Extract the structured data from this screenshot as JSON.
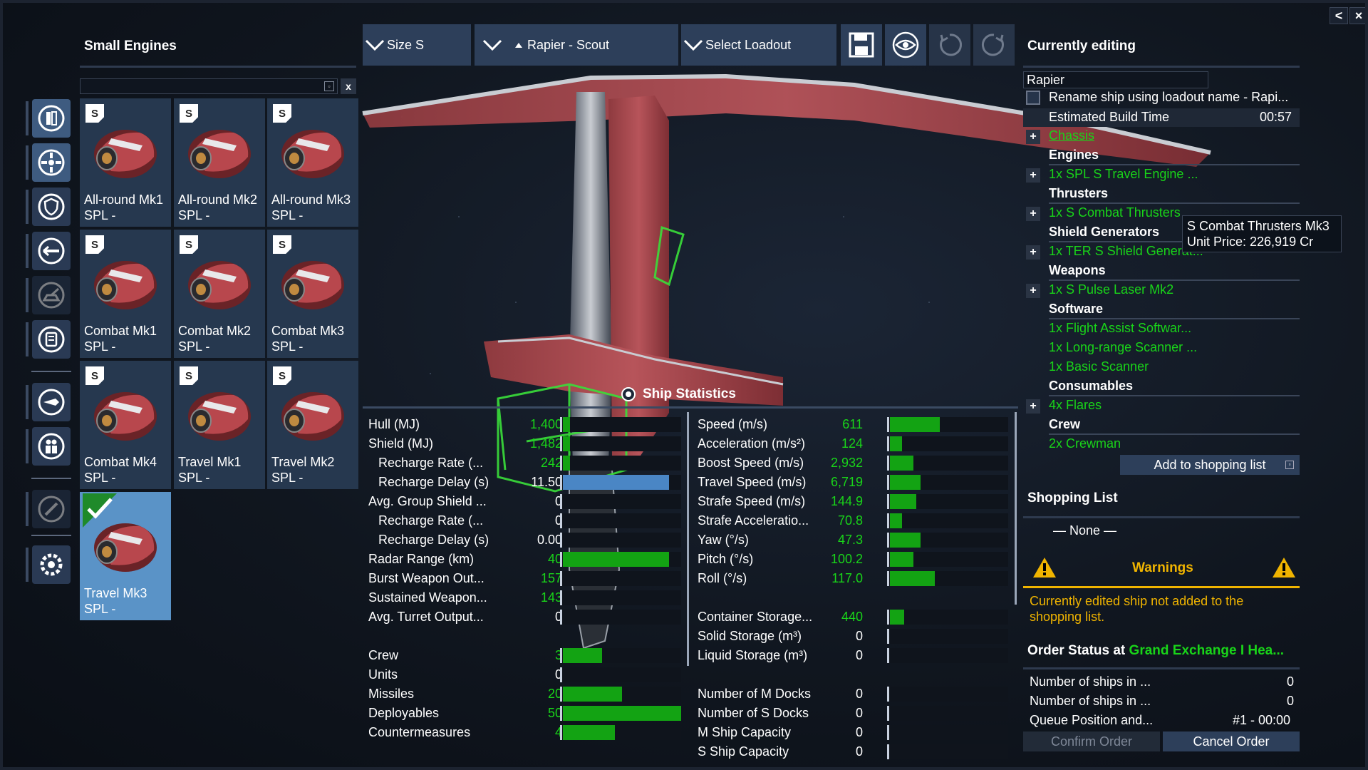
{
  "window_controls": {
    "back": "<",
    "close": "×"
  },
  "engines_panel": {
    "title": "Small Engines",
    "search_value": "",
    "search_clear_glyph": "▫",
    "clear_button": "x",
    "size_badge": "S",
    "items": [
      {
        "name": "All-round Mk1",
        "sub": "SPL -"
      },
      {
        "name": "All-round Mk2",
        "sub": "SPL -"
      },
      {
        "name": "All-round Mk3",
        "sub": "SPL -"
      },
      {
        "name": "Combat Mk1",
        "sub": "SPL -"
      },
      {
        "name": "Combat Mk2",
        "sub": "SPL -"
      },
      {
        "name": "Combat Mk3",
        "sub": "SPL -"
      },
      {
        "name": "Combat Mk4",
        "sub": "SPL -"
      },
      {
        "name": "Travel Mk1",
        "sub": "SPL -"
      },
      {
        "name": "Travel Mk2",
        "sub": "SPL -"
      },
      {
        "name": "Travel Mk3",
        "sub": "SPL -",
        "selected": true
      }
    ]
  },
  "rail_icons": [
    "chassis-icon",
    "engine-icon",
    "shield-icon",
    "weapon-icon",
    "turret-icon",
    "consumable-icon",
    "missile-icon",
    "crew-icon",
    "paint-icon",
    "settings-icon"
  ],
  "toolbar": {
    "size_label": "Size S",
    "ship_label": "Rapier - Scout",
    "loadout_label": "Select Loadout"
  },
  "stats": {
    "title": "Ship Statistics",
    "left": [
      {
        "label": "Hull (MJ)",
        "value": "1,400",
        "fraction": 0.06,
        "color": "green"
      },
      {
        "label": "Shield (MJ)",
        "value": "1,482",
        "fraction": 0.06,
        "color": "green"
      },
      {
        "label": "Recharge Rate (...",
        "value": "242",
        "fraction": 0.06,
        "color": "green",
        "indent": true
      },
      {
        "label": "Recharge Delay (s)",
        "value": "11.50",
        "fraction": 0.9,
        "color": "white",
        "blue": true,
        "indent": true
      },
      {
        "label": "Avg. Group Shield ...",
        "value": "0",
        "fraction": 0,
        "color": "white"
      },
      {
        "label": "Recharge Rate (...",
        "value": "0",
        "fraction": 0,
        "color": "white",
        "indent": true
      },
      {
        "label": "Recharge Delay (s)",
        "value": "0.00",
        "fraction": 0,
        "color": "white",
        "indent": true
      },
      {
        "label": "Radar Range (km)",
        "value": "40",
        "fraction": 0.9,
        "color": "green"
      },
      {
        "label": "Burst Weapon Out...",
        "value": "157",
        "fraction": 0,
        "color": "green"
      },
      {
        "label": "Sustained Weapon...",
        "value": "143",
        "fraction": 0,
        "color": "green"
      },
      {
        "label": "Avg. Turret Output...",
        "value": "0",
        "fraction": 0,
        "color": "white"
      },
      {
        "gap": true
      },
      {
        "label": "Crew",
        "value": "3",
        "fraction": 0.33,
        "color": "green"
      },
      {
        "label": "Units",
        "value": "0",
        "fraction": 0,
        "color": "white"
      },
      {
        "label": "Missiles",
        "value": "20",
        "fraction": 0.5,
        "color": "green"
      },
      {
        "label": "Deployables",
        "value": "50",
        "fraction": 1.0,
        "color": "green"
      },
      {
        "label": "Countermeasures",
        "value": "4",
        "fraction": 0.44,
        "color": "green"
      }
    ],
    "right": [
      {
        "label": "Speed (m/s)",
        "value": "611",
        "fraction": 0.42,
        "color": "green"
      },
      {
        "label": "Acceleration (m/s²)",
        "value": "124",
        "fraction": 0.1,
        "color": "green"
      },
      {
        "label": "Boost Speed (m/s)",
        "value": "2,932",
        "fraction": 0.2,
        "color": "green"
      },
      {
        "label": "Travel Speed (m/s)",
        "value": "6,719",
        "fraction": 0.26,
        "color": "green"
      },
      {
        "label": "Strafe Speed (m/s)",
        "value": "144.9",
        "fraction": 0.22,
        "color": "green"
      },
      {
        "label": "Strafe Acceleratio...",
        "value": "70.8",
        "fraction": 0.1,
        "color": "green"
      },
      {
        "label": "Yaw (°/s)",
        "value": "47.3",
        "fraction": 0.26,
        "color": "green"
      },
      {
        "label": "Pitch (°/s)",
        "value": "100.2",
        "fraction": 0.2,
        "color": "green"
      },
      {
        "label": "Roll (°/s)",
        "value": "117.0",
        "fraction": 0.38,
        "color": "green"
      },
      {
        "gap": true
      },
      {
        "label": "Container Storage...",
        "value": "440",
        "fraction": 0.12,
        "color": "green"
      },
      {
        "label": "Solid Storage (m³)",
        "value": "0",
        "fraction": 0,
        "color": "white"
      },
      {
        "label": "Liquid Storage (m³)",
        "value": "0",
        "fraction": 0,
        "color": "white"
      },
      {
        "gap": true
      },
      {
        "label": "Number of M Docks",
        "value": "0",
        "fraction": 0,
        "color": "white"
      },
      {
        "label": "Number of S Docks",
        "value": "0",
        "fraction": 0,
        "color": "white"
      },
      {
        "label": "M Ship Capacity",
        "value": "0",
        "fraction": 0,
        "color": "white"
      },
      {
        "label": "S Ship Capacity",
        "value": "0",
        "fraction": 0,
        "color": "white"
      }
    ]
  },
  "editing": {
    "title": "Currently editing",
    "ship_name": "Rapier",
    "rename_label": "Rename ship using loadout name - Rapi...",
    "build_time_label": "Estimated Build Time",
    "build_time_value": "00:57",
    "plus_glyph": "+",
    "chassis": "Chassis",
    "engines_header": "Engines",
    "engines_item": "1x SPL S Travel Engine ...",
    "thrusters_header": "Thrusters",
    "thrusters_item": "1x S Combat Thrusters ...",
    "shields_header": "Shield Generators",
    "shields_item": "1x TER S Shield Generat...",
    "weapons_header": "Weapons",
    "weapons_item": "1x S Pulse Laser Mk2",
    "software_header": "Software",
    "software_items": [
      "1x Flight Assist Softwar...",
      "1x Long-range Scanner ...",
      "1x Basic Scanner"
    ],
    "consumables_header": "Consumables",
    "consumables_item": "4x Flares",
    "crew_header": "Crew",
    "crew_item": "2x Crewman",
    "add_button": "Add to shopping list",
    "add_button_glyph": "▫"
  },
  "tooltip": {
    "line1": "S Combat Thrusters Mk3",
    "line2": "Unit Price: 226,919 Cr"
  },
  "shopping": {
    "title": "Shopping List",
    "empty": "— None —"
  },
  "warnings": {
    "title": "Warnings",
    "text": "Currently edited ship not added to the shopping list.",
    "color": "#f0b400"
  },
  "order": {
    "title_prefix": "Order Status at ",
    "station": "Grand Exchange I Hea...",
    "rows": [
      {
        "label": "Number of ships in ...",
        "value": "0"
      },
      {
        "label": "Number of ships in ...",
        "value": "0"
      },
      {
        "label": "Queue Position and...",
        "value": "#1 - 00:00"
      }
    ],
    "confirm_button": "Confirm Order",
    "cancel_button": "Cancel Order"
  },
  "colors": {
    "accent_green": "#19d419",
    "warning": "#f0b400",
    "panel": "#2d3f5a",
    "selected": "#5a93c7"
  }
}
